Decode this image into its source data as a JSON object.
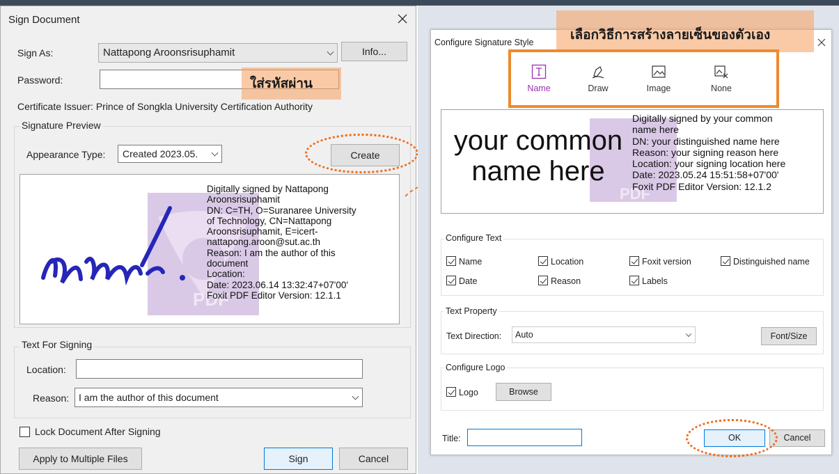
{
  "sign_dialog": {
    "title": "Sign Document",
    "sign_as_label": "Sign As:",
    "sign_as_value": "Nattapong Aroonsrisuphamit",
    "info_button": "Info...",
    "password_label": "Password:",
    "password_hint": "ใส่รหัสผ่าน",
    "certificate_issuer": "Certificate Issuer:  Prince of Songkla University Certification Authority",
    "signature_preview_title": "Signature Preview",
    "appearance_label": "Appearance Type:",
    "appearance_value": "Created 2023.05.",
    "create_button": "Create",
    "preview_lines": [
      "Digitally signed by Nattapong",
      "Aroonsrisuphamit",
      "DN: C=TH, O=Suranaree University",
      "of Technology, CN=Nattapong",
      "Aroonsrisuphamit, E=icert-",
      "nattapong.aroon@sut.ac.th",
      "Reason: I am the author of this",
      "document",
      "Location:",
      "Date: 2023.06.14 13:32:47+07'00'",
      "Foxit PDF Editor Version: 12.1.1"
    ],
    "text_for_signing_title": "Text For Signing",
    "location_label": "Location:",
    "location_value": "",
    "reason_label": "Reason:",
    "reason_value": "I am the author of this document",
    "lock_label": "Lock Document After Signing",
    "apply_multiple_button": "Apply to Multiple Files",
    "sign_button": "Sign",
    "cancel_button": "Cancel"
  },
  "style_dialog": {
    "title": "Configure Signature Style",
    "banner": "เลือกวิธีการสร้างลายเซ็นของตัวเอง",
    "tabs": [
      "Name",
      "Draw",
      "Image",
      "None"
    ],
    "preview_name": [
      "your common",
      "name here"
    ],
    "preview_lines": [
      "Digitally signed by your common",
      "name here",
      "DN: your distinguished name here",
      "Reason: your signing reason here",
      "Location: your signing location here",
      "Date: 2023.05.24 15:51:58+07'00'",
      "Foxit PDF Editor Version: 12.1.2"
    ],
    "configure_text_title": "Configure Text",
    "checkboxes": [
      "Name",
      "Location",
      "Foxit version",
      "Distinguished name",
      "Date",
      "Reason",
      "Labels"
    ],
    "text_property_title": "Text Property",
    "text_direction_label": "Text Direction:",
    "text_direction_value": "Auto",
    "font_size_button": "Font/Size",
    "configure_logo_title": "Configure Logo",
    "logo_label": "Logo",
    "browse_button": "Browse",
    "title_label": "Title:",
    "title_value": "",
    "ok_button": "OK",
    "cancel_button": "Cancel"
  },
  "logo_text": "PDF",
  "colors": {
    "accent_orange": "#ef6c1a",
    "tab_active": "#9b2fb5",
    "highlight": "#f7a76d"
  }
}
